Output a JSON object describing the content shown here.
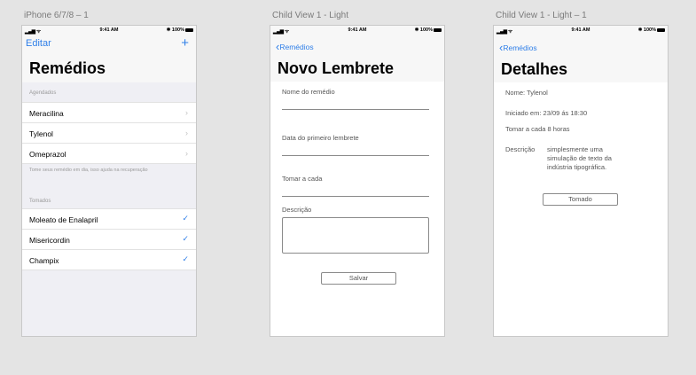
{
  "artboards": {
    "list": {
      "label": "iPhone 6/7/8 – 1",
      "status": {
        "time": "9:41 AM",
        "battery": "100%"
      },
      "edit_label": "Editar",
      "add_label": "+",
      "title": "Remédios",
      "scheduled_header": "Agendados",
      "scheduled": [
        {
          "name": "Meracilina"
        },
        {
          "name": "Tylenol"
        },
        {
          "name": "Omeprazol"
        }
      ],
      "scheduled_footer": "Tome seus remédio em dia, isso ajuda na recuperação",
      "taken_header": "Tomados",
      "taken": [
        {
          "name": "Moleato de Enalapril"
        },
        {
          "name": "Misericordin"
        },
        {
          "name": "Champix"
        }
      ]
    },
    "new": {
      "label": "Child View 1 - Light",
      "status": {
        "time": "9:41 AM",
        "battery": "100%"
      },
      "back_label": "Remédios",
      "title": "Novo Lembrete",
      "fields": {
        "name": "Nome do remédio",
        "first_reminder": "Data do primeiro lembrete",
        "interval": "Tomar a cada",
        "description": "Descrição"
      },
      "save_label": "Salvar"
    },
    "details": {
      "label": "Child View 1 - Light – 1",
      "status": {
        "time": "9:41 AM",
        "battery": "100%"
      },
      "back_label": "Remédios",
      "title": "Detalhes",
      "name": "Nome: Tylenol",
      "started": "Iniciado em: 23/09 ás 18:30",
      "interval": "Tomar a cada 8 horas",
      "description_label": "Descrição",
      "description": "simplesmente uma simulação de texto da indústria tipográfica.",
      "taken_label": "Tomado"
    }
  },
  "colors": {
    "accent": "#2f7fe8",
    "canvas": "#e4e4e4",
    "grouped_bg": "#efeff4"
  }
}
